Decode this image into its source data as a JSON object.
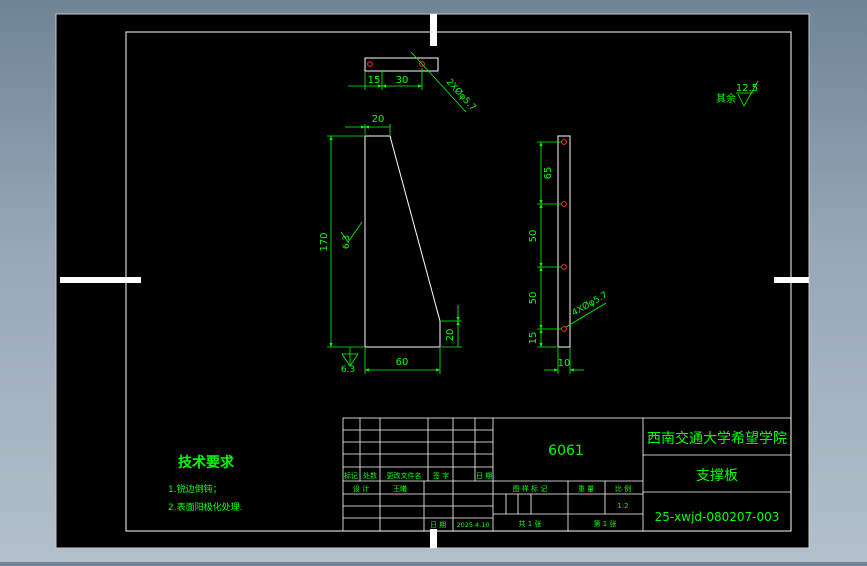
{
  "drawing": {
    "background_color": "#000000",
    "frame_color": "#ffffff",
    "dimension_color": "#00ff00",
    "part_color": "#ffffff",
    "hole_color": "#ff3030"
  },
  "top_view": {
    "dims": [
      "15",
      "30"
    ],
    "hole_note": "2XØφ5.7"
  },
  "front_view": {
    "dim_top": "20",
    "dim_height": "170",
    "dim_bottom": "60",
    "dim_right": "20",
    "roughness_left": "6.3",
    "roughness_bottom": "6.3"
  },
  "side_view": {
    "dims": [
      "65",
      "50",
      "50",
      "15"
    ],
    "dim_width": "10",
    "hole_note": "4XØφ5.7"
  },
  "roughness_rest": {
    "label": "其余",
    "value": "12.5"
  },
  "tech_requirements": {
    "title": "技术要求",
    "items": [
      "1.锐边倒钝；",
      "2.表面阳极化处理."
    ]
  },
  "title_block": {
    "material": "6061",
    "school": "西南交通大学希望学院",
    "part_name": "支撑板",
    "drawing_number": "25-xwjd-080207-003",
    "header_labels": [
      "标记",
      "处数",
      "更改文件名",
      "签 字",
      "日 期"
    ],
    "design_label": "设 计",
    "designer": "王曦",
    "date_label": "日 期",
    "date": "2025.4.10",
    "stage_labels": [
      "图 样 标 记",
      "重 量",
      "比 例"
    ],
    "scale": "1:2",
    "sheets_total": "共  1  张",
    "sheet_number": "第  1  张"
  }
}
